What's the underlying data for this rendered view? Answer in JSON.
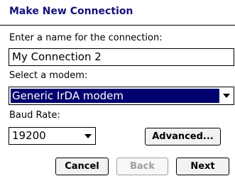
{
  "header": {
    "title": "Make New Connection"
  },
  "name_field": {
    "label": "Enter a name for the connection:",
    "value": "My Connection 2"
  },
  "modem": {
    "label": "Select a modem:",
    "selected": "Generic IrDA modem"
  },
  "baud": {
    "label": "Baud Rate:",
    "selected": "19200"
  },
  "buttons": {
    "advanced": "Advanced...",
    "cancel": "Cancel",
    "back": "Back",
    "next": "Next"
  },
  "colors": {
    "title": "#14127a",
    "selection": "#00006f",
    "disabled_text": "#a0a0a0"
  },
  "states": {
    "back_enabled": false
  }
}
